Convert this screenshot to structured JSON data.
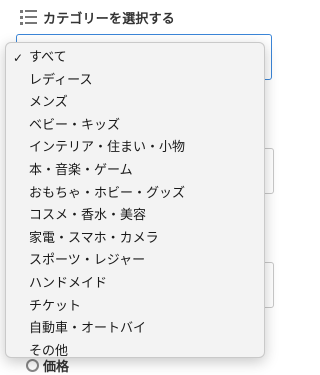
{
  "header": {
    "icon": "list-icon",
    "title": "カテゴリーを選択する"
  },
  "category_select": {
    "selected_value": "すべて",
    "options": [
      "すべて",
      "レディース",
      "メンズ",
      "ベビー・キッズ",
      "インテリア・住まい・小物",
      "本・音楽・ゲーム",
      "おもちゃ・ホビー・グッズ",
      "コスメ・香水・美容",
      "家電・スマホ・カメラ",
      "スポーツ・レジャー",
      "ハンドメイド",
      "チケット",
      "自動車・オートバイ",
      "その他"
    ],
    "check_glyph": "✓"
  },
  "bottom_section": {
    "label": "価格"
  },
  "colors": {
    "focus_border": "#3b86d8",
    "dropdown_bg": "#f3f3f3"
  }
}
